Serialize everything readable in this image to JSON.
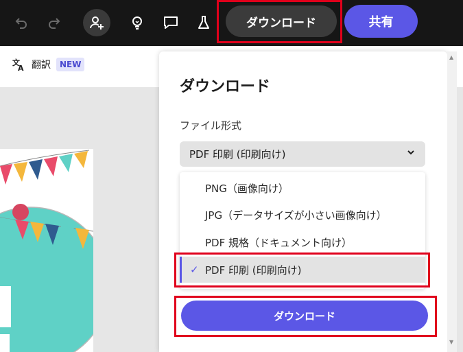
{
  "toolbar": {
    "undo_icon": "undo-icon",
    "redo_icon": "redo-icon",
    "add_user_icon": "add-user-icon",
    "idea_icon": "lightbulb-icon",
    "comment_icon": "comment-icon",
    "lab_icon": "flask-icon",
    "download_label": "ダウンロード",
    "share_label": "共有"
  },
  "subbar": {
    "translate_label": "翻訳",
    "new_badge": "NEW"
  },
  "panel": {
    "title": "ダウンロード",
    "format_label": "ファイル形式",
    "selected_value": "PDF 印刷 (印刷向け)",
    "options": [
      {
        "label": "PNG（画像向け）"
      },
      {
        "label": "JPG（データサイズが小さい画像向け）"
      },
      {
        "label": "PDF 規格（ドキュメント向け）"
      },
      {
        "label": "PDF 印刷 (印刷向け)",
        "selected": true
      }
    ],
    "download_button": "ダウンロード"
  },
  "colors": {
    "accent": "#5b57e6",
    "highlight": "#e0001b",
    "toolbar_bg": "#161616"
  }
}
